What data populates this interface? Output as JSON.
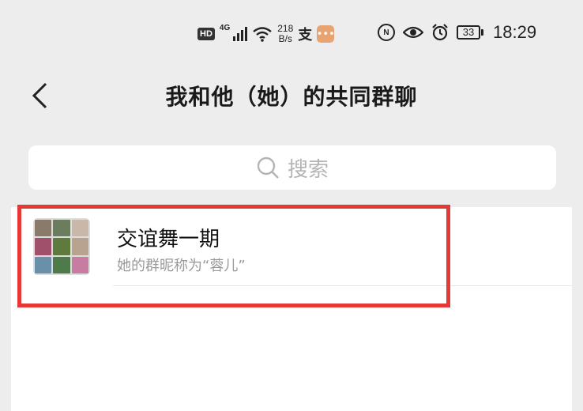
{
  "status_bar": {
    "hd": "HD",
    "network": "4G",
    "speed_value": "218",
    "speed_unit": "B/s",
    "battery": "33",
    "time": "18:29"
  },
  "header": {
    "title": "我和他（她）的共同群聊"
  },
  "search": {
    "placeholder": "搜索"
  },
  "groups": [
    {
      "name": "交谊舞一期",
      "subtitle": "她的群昵称为“蓉儿”"
    }
  ],
  "colors": {
    "background": "#ededed",
    "highlight": "#e53935",
    "pay_icon": "#e8a372"
  }
}
